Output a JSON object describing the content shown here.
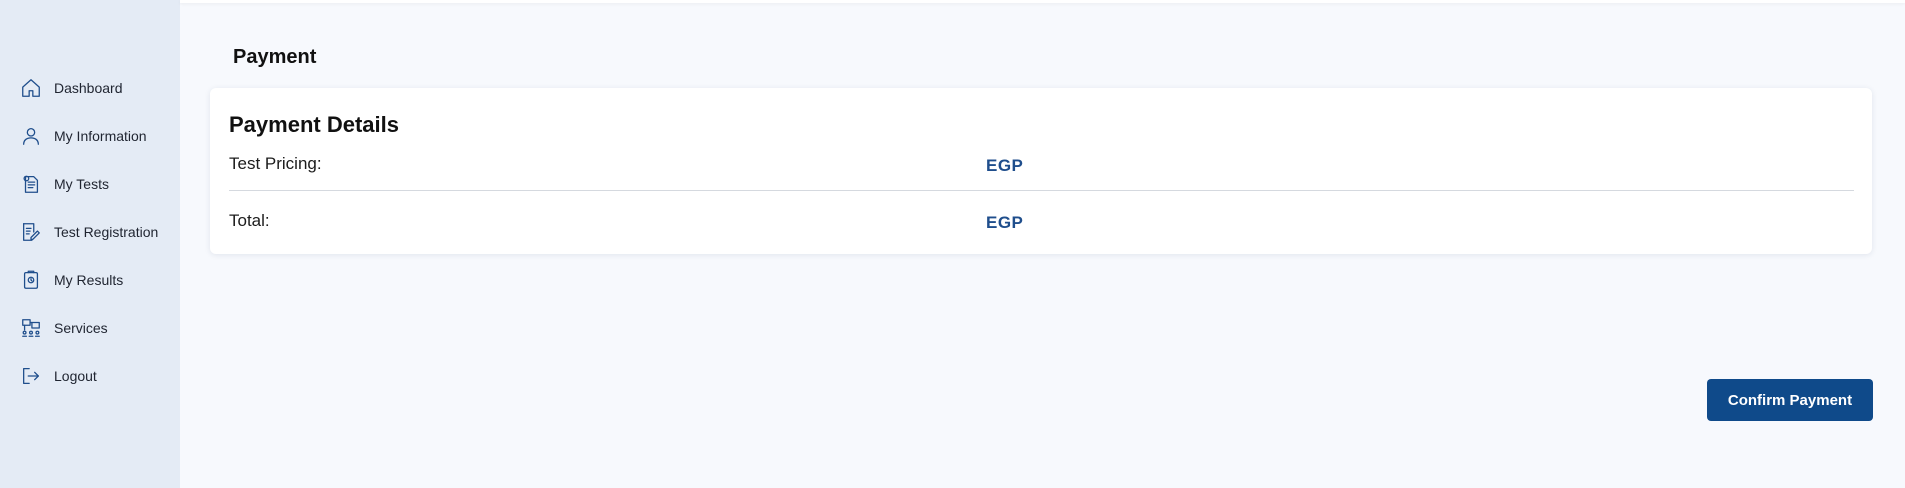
{
  "sidebar": {
    "items": [
      {
        "label": "Dashboard",
        "icon": "home-icon"
      },
      {
        "label": "My Information",
        "icon": "user-icon"
      },
      {
        "label": "My Tests",
        "icon": "tests-icon"
      },
      {
        "label": "Test Registration",
        "icon": "registration-icon"
      },
      {
        "label": "My Results",
        "icon": "results-icon"
      },
      {
        "label": "Services",
        "icon": "services-icon"
      },
      {
        "label": "Logout",
        "icon": "logout-icon"
      }
    ]
  },
  "page": {
    "title": "Payment"
  },
  "payment_details": {
    "title": "Payment Details",
    "rows": [
      {
        "label": "Test Pricing:",
        "value": "EGP"
      },
      {
        "label": "Total:",
        "value": "EGP"
      }
    ]
  },
  "actions": {
    "confirm_label": "Confirm Payment"
  },
  "colors": {
    "accent": "#0f4a8a",
    "sidebar_bg": "#e4ebf5",
    "value_text": "#1f4e8c"
  }
}
